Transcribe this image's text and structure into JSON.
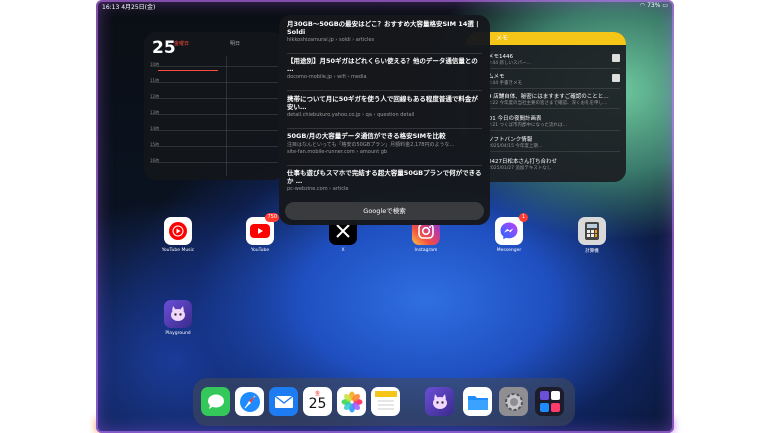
{
  "status": {
    "time": "16:13",
    "date": "4月25日(金)",
    "battery": "73%"
  },
  "calendar": {
    "day": "25",
    "dow": "金曜日",
    "dow_sub": "",
    "col2": "明日",
    "hours": [
      "10時",
      "11時",
      "12時",
      "13時",
      "14時",
      "15時",
      "16時"
    ]
  },
  "notes": {
    "header": "メモ",
    "items": [
      {
        "title": "メモ1446",
        "sub": "2:44  新しいスパー…"
      },
      {
        "title": "ムメモ",
        "sub": "2:44  手書きメモ"
      },
      {
        "title": "9  店舗自体、秘密にはますますご確認のことと…",
        "sub": "2:22  今年度の当社主要の皆さまで確認、深くお礼を申し…"
      },
      {
        "title": "D1 今日の夜間計画表",
        "sub": "2:21  つくば市内郡中になった流れは…"
      },
      {
        "title": "ソフトバンク情報",
        "sub": "2025/04/15  今年度上期…"
      },
      {
        "title": "0427日松本さん打ち合わせ",
        "sub": "2025/01/27  追加テキストなし"
      }
    ]
  },
  "search": {
    "results": [
      {
        "title": "月30GB〜50GBの最安はどこ？おすすめ大容量格安SIM 14選 | Soldi",
        "source": "hikkoshizamurai.jp › soldi › articles"
      },
      {
        "title": "【用途別】月50ギガはどれくらい使える？他のデータ通信量との …",
        "source": "docomo-mobile.jp › wifi › media"
      },
      {
        "title": "携帯について月に50ギガを使う人で回線もある程度普通で料金が安い…",
        "source": "detail.chiebukuro.yahoo.co.jp › qa › question detail"
      },
      {
        "title": "50GB/月の大容量データ通信ができる格安SIMを比較",
        "source": "注目はなんといっても「格安の50GBプラン」月額料金2,178円のような…"
      },
      {
        "title": "仕事も遊びもスマホで完結する超大容量50GBプランで何ができるか …",
        "source": "pc-webzine.com › article"
      }
    ],
    "extra_source_line": "site-fan.mobile-runner.com › amount gb",
    "google_button": "Googleで検索"
  },
  "apps": {
    "youtube_music": {
      "label": "YouTube Music"
    },
    "youtube": {
      "label": "YouTube",
      "badge": "750"
    },
    "x": {
      "label": "X"
    },
    "instagram": {
      "label": "Instagram"
    },
    "messenger": {
      "label": "Messenger",
      "badge": "1"
    },
    "calculator": {
      "label": "計算機"
    },
    "playground": {
      "label": "Playground"
    }
  },
  "dock": {
    "calendar_day": "25",
    "calendar_dow": "金"
  },
  "colors": {
    "notes_accent": "#f5c518",
    "badge": "#ff3b30",
    "calendar_accent": "#ff4b3e"
  }
}
